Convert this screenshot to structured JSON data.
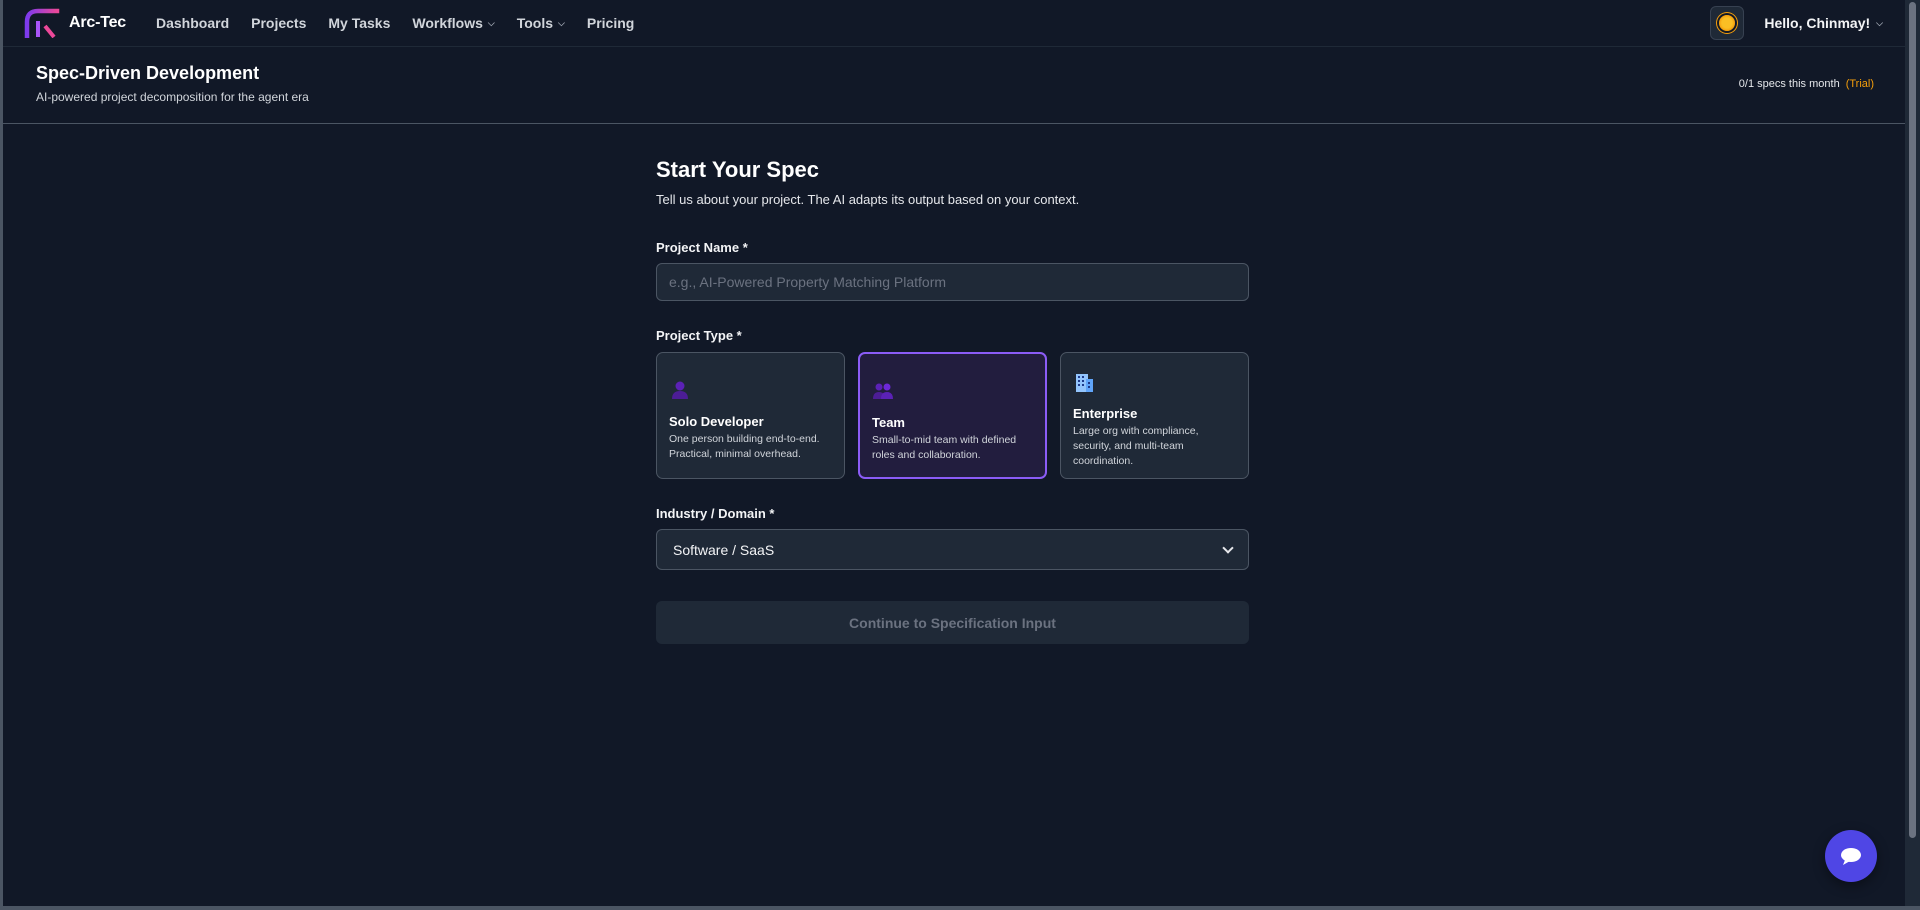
{
  "app": {
    "name": "Arc-Tec",
    "logo_icon": "arc-logo-icon"
  },
  "nav": {
    "items": [
      {
        "label": "Dashboard",
        "has_caret": false
      },
      {
        "label": "Projects",
        "has_caret": false
      },
      {
        "label": "My Tasks",
        "has_caret": false
      },
      {
        "label": "Workflows",
        "has_caret": true
      },
      {
        "label": "Tools",
        "has_caret": true
      },
      {
        "label": "Pricing",
        "has_caret": false
      }
    ],
    "theme_icon": "sun-icon",
    "user_greeting": "Hello, Chinmay!"
  },
  "header": {
    "title": "Spec-Driven Development",
    "subtitle": "AI-powered project decomposition for the agent era",
    "usage": "0/1 specs this month",
    "plan": "(Trial)"
  },
  "form": {
    "title": "Start Your Spec",
    "intro": "Tell us about your project. The AI adapts its output based on your context.",
    "project_name_label": "Project Name *",
    "project_name_placeholder": "e.g., AI-Powered Property Matching Platform",
    "project_name_value": "",
    "project_type_label": "Project Type *",
    "project_types": [
      {
        "title": "Solo Developer",
        "description": "One person building end-to-end. Practical, minimal overhead.",
        "icon": "person-icon",
        "selected": false
      },
      {
        "title": "Team",
        "description": "Small-to-mid team with defined roles and collaboration.",
        "icon": "people-icon",
        "selected": true
      },
      {
        "title": "Enterprise",
        "description": "Large org with compliance, security, and multi-team coordination.",
        "icon": "office-building-icon",
        "selected": false
      }
    ],
    "domain_label": "Industry / Domain *",
    "domain_selected": "Software / SaaS",
    "continue_label": "Continue to Specification Input"
  },
  "chat": {
    "icon": "chat-bubble-icon"
  },
  "colors": {
    "background": "#111827",
    "accent": "#8b5cf6",
    "trial": "#f59e0b",
    "chat_button": "#4f46e5"
  }
}
